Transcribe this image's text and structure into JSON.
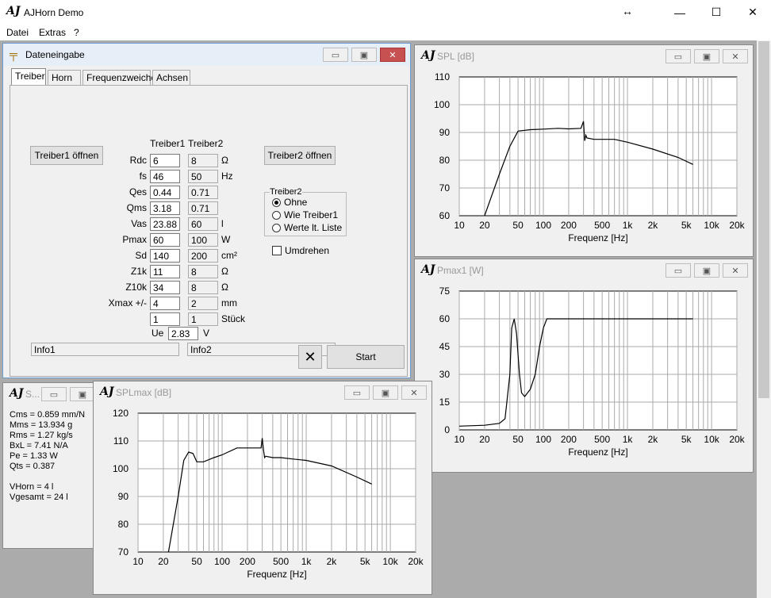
{
  "app": {
    "title": "AJHorn Demo",
    "logo": "AJ",
    "resize_glyph": "↔",
    "min_glyph": "—",
    "max_glyph": "☐",
    "close_glyph": "✕"
  },
  "menu": [
    "Datei",
    "Extras",
    "?"
  ],
  "dateneingabe": {
    "title": "Dateneingabe",
    "tabs": [
      "Treiber",
      "Horn",
      "Frequenzweiche",
      "Achsen"
    ],
    "btn_t1": "Treiber1 öffnen",
    "btn_t2": "Treiber2 öffnen",
    "col1": "Treiber1",
    "col2": "Treiber2",
    "rows": [
      {
        "label": "Rdc",
        "v1": "6",
        "v2": "8",
        "unit": "Ω"
      },
      {
        "label": "fs",
        "v1": "46",
        "v2": "50",
        "unit": "Hz"
      },
      {
        "label": "Qes",
        "v1": "0.44",
        "v2": "0.71",
        "unit": ""
      },
      {
        "label": "Qms",
        "v1": "3.18",
        "v2": "0.71",
        "unit": ""
      },
      {
        "label": "Vas",
        "v1": "23.88",
        "v2": "60",
        "unit": "l"
      },
      {
        "label": "Pmax",
        "v1": "60",
        "v2": "100",
        "unit": "W"
      },
      {
        "label": "Sd",
        "v1": "140",
        "v2": "200",
        "unit": "cm²"
      },
      {
        "label": "Z1k",
        "v1": "11",
        "v2": "8",
        "unit": "Ω"
      },
      {
        "label": "Z10k",
        "v1": "34",
        "v2": "8",
        "unit": "Ω"
      },
      {
        "label": "Xmax +/-",
        "v1": "4",
        "v2": "2",
        "unit": "mm"
      },
      {
        "label": "",
        "v1": "1",
        "v2": "1",
        "unit": "Stück"
      }
    ],
    "ue_label": "Ue",
    "ue_value": "2.83",
    "ue_unit": "V",
    "info1": "Info1",
    "info2": "Info2",
    "group_title": "Treiber2",
    "radios": [
      "Ohne",
      "Wie Treiber1",
      "Werte lt. Liste"
    ],
    "selected_radio": 0,
    "checkbox": "Umdrehen",
    "start": "Start",
    "cancel_glyph": "✕",
    "colors": [
      "#000000",
      "#ff0000",
      "#008000",
      "#0000ff"
    ]
  },
  "spl": {
    "title": "SPL [dB]",
    "xlabel": "Frequenz [Hz]"
  },
  "pmax": {
    "title": "Pmax1 [W]",
    "xlabel": "Frequenz [Hz]"
  },
  "splmax": {
    "title": "SPLmax [dB]",
    "xlabel": "Frequenz [Hz]"
  },
  "small": {
    "title": "S...",
    "lines": [
      "Cms = 0.859 mm/N",
      "Mms = 13.934 g",
      "Rms = 1.27 kg/s",
      "BxL = 7.41 N/A",
      "Pe = 1.33 W",
      "Qts = 0.387",
      "",
      "VHorn = 4 l",
      "Vgesamt = 24 l"
    ]
  },
  "chart_data": [
    {
      "type": "line",
      "title": "SPL [dB]",
      "xlabel": "Frequenz [Hz]",
      "xscale": "log",
      "xlim": [
        10,
        20000
      ],
      "ylim": [
        60,
        110
      ],
      "xticks": [
        "10",
        "20",
        "50",
        "100",
        "200",
        "500",
        "1k",
        "2k",
        "5k",
        "10k",
        "20k"
      ],
      "yticks": [
        "60",
        "70",
        "80",
        "90",
        "100",
        "110"
      ],
      "x": [
        20,
        30,
        40,
        50,
        70,
        100,
        150,
        200,
        280,
        300,
        310,
        320,
        330,
        400,
        500,
        700,
        1000,
        2000,
        4000,
        6000
      ],
      "y": [
        60,
        75,
        85,
        90.5,
        91,
        91.2,
        91.5,
        91.3,
        91.5,
        94,
        87,
        89,
        88,
        87.5,
        87.5,
        87.5,
        86.5,
        84,
        81,
        78.5
      ]
    },
    {
      "type": "line",
      "title": "Pmax1 [W]",
      "xlabel": "Frequenz [Hz]",
      "xscale": "log",
      "xlim": [
        10,
        20000
      ],
      "ylim": [
        0,
        75
      ],
      "xticks": [
        "10",
        "20",
        "50",
        "100",
        "200",
        "500",
        "1k",
        "2k",
        "5k",
        "10k",
        "20k"
      ],
      "yticks": [
        "0",
        "15",
        "30",
        "45",
        "60",
        "75"
      ],
      "x": [
        10,
        20,
        30,
        35,
        40,
        42,
        45,
        48,
        52,
        55,
        60,
        70,
        80,
        90,
        100,
        110,
        6000
      ],
      "y": [
        2,
        2.5,
        3.5,
        6,
        30,
        55,
        60,
        52,
        30,
        20,
        18,
        22,
        30,
        45,
        55,
        60,
        60
      ]
    },
    {
      "type": "line",
      "title": "SPLmax [dB]",
      "xlabel": "Frequenz [Hz]",
      "xscale": "log",
      "xlim": [
        10,
        20000
      ],
      "ylim": [
        70,
        120
      ],
      "xticks": [
        "10",
        "20",
        "50",
        "100",
        "200",
        "500",
        "1k",
        "2k",
        "5k",
        "10k",
        "20k"
      ],
      "yticks": [
        "70",
        "80",
        "90",
        "100",
        "110",
        "120"
      ],
      "x": [
        23,
        30,
        35,
        40,
        45,
        50,
        60,
        80,
        100,
        150,
        200,
        290,
        300,
        310,
        320,
        330,
        400,
        500,
        700,
        1000,
        2000,
        4000,
        6000
      ],
      "y": [
        70,
        90,
        103,
        106,
        105.5,
        102.5,
        102.5,
        104,
        105,
        107.5,
        107.5,
        107.5,
        111,
        107,
        104,
        104.5,
        104,
        104,
        103.5,
        103,
        101,
        97,
        94.5
      ]
    }
  ]
}
